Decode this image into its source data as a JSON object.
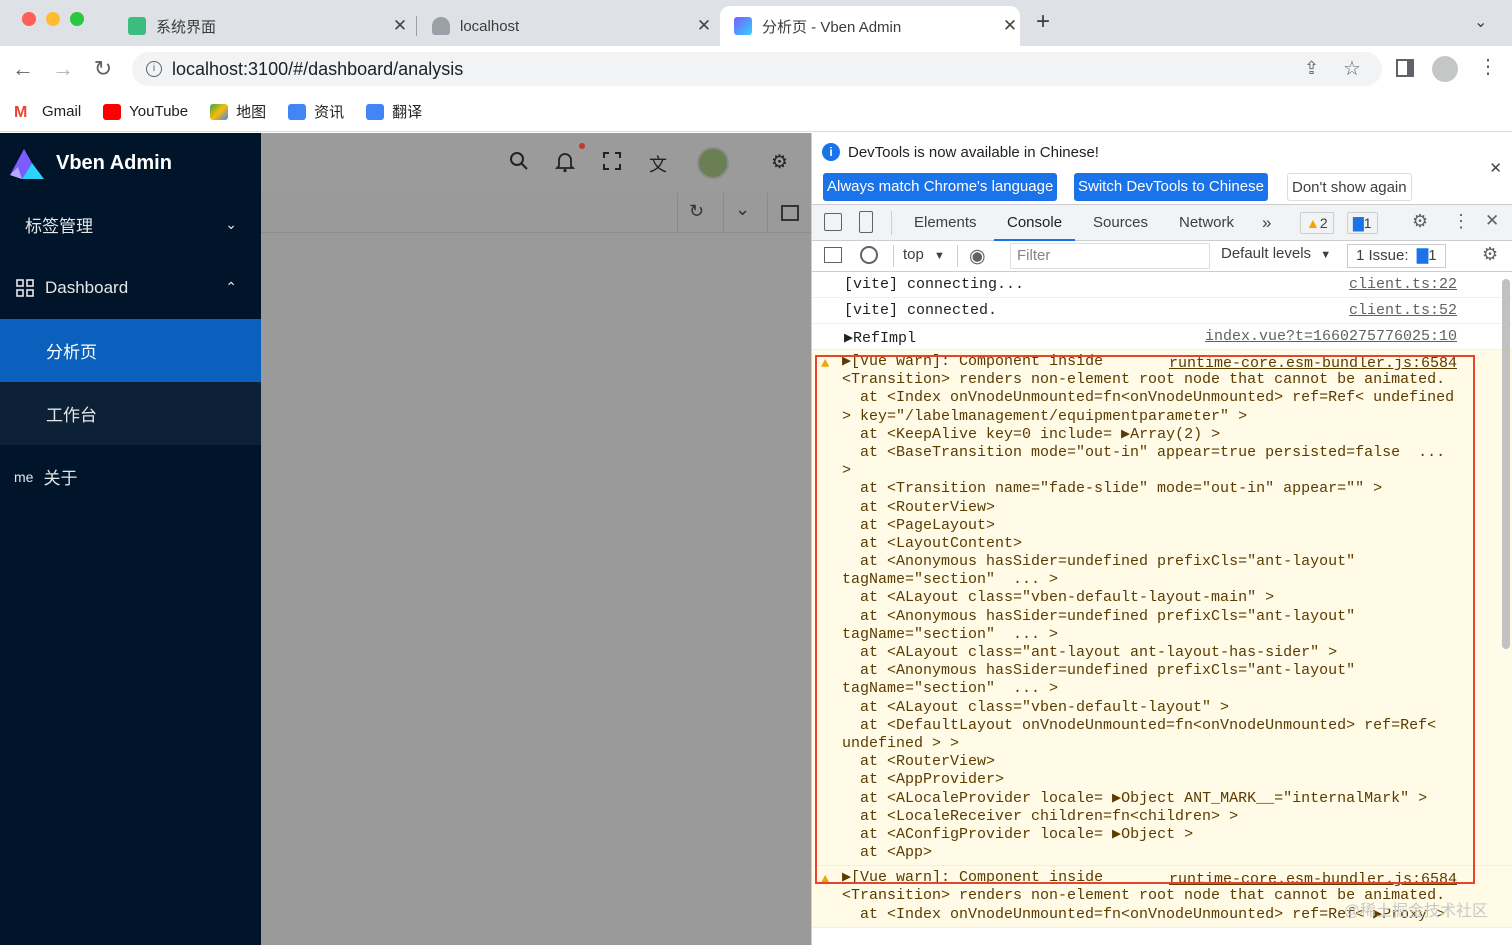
{
  "browser": {
    "tabs": [
      {
        "label": "系统界面",
        "active": false
      },
      {
        "label": "localhost",
        "active": false
      },
      {
        "label": "分析页 - Vben Admin",
        "active": true
      }
    ],
    "address": "localhost:3100/#/dashboard/analysis",
    "bookmarks": [
      "Gmail",
      "YouTube",
      "地图",
      "资讯",
      "翻译"
    ]
  },
  "app": {
    "brand": "Vben Admin",
    "menu": {
      "tag_management": "标签管理",
      "dashboard": "Dashboard",
      "analysis": "分析页",
      "workbench": "工作台",
      "about_prefix": "me",
      "about": "关于"
    }
  },
  "devtools": {
    "notice": "DevTools is now available in Chinese!",
    "btn_match": "Always match Chrome's language",
    "btn_switch": "Switch DevTools to Chinese",
    "btn_dont_show": "Don't show again",
    "tabs": [
      "Elements",
      "Console",
      "Sources",
      "Network"
    ],
    "more_tabs": "»",
    "warn_count": "2",
    "issue_count": "1",
    "context": "top",
    "filter_placeholder": "Filter",
    "levels": "Default levels",
    "issues_label": "1 Issue:",
    "issues_badge": "1"
  },
  "console": {
    "lines": [
      {
        "text": "[vite] connecting...",
        "source": "client.ts:22"
      },
      {
        "text": "[vite] connected.",
        "source": "client.ts:52"
      },
      {
        "text": "▶RefImpl",
        "source": "index.vue?t=1660275776025:10"
      }
    ],
    "warn1_source": "runtime-core.esm-bundler.js:6584",
    "warn1_lines": [
      "▶[Vue warn]: Component inside",
      "<Transition> renders non-element root node that cannot be animated.",
      "  at <Index onVnodeUnmounted=fn<onVnodeUnmounted> ref=Ref< undefined",
      "> key=\"/labelmanagement/equipmentparameter\" >",
      "  at <KeepAlive key=0 include= ▶Array(2) >",
      "  at <BaseTransition mode=\"out-in\" appear=true persisted=false  ...",
      ">",
      "  at <Transition name=\"fade-slide\" mode=\"out-in\" appear=\"\" >",
      "  at <RouterView>",
      "  at <PageLayout>",
      "  at <LayoutContent>",
      "  at <Anonymous hasSider=undefined prefixCls=\"ant-layout\"",
      "tagName=\"section\"  ... >",
      "  at <ALayout class=\"vben-default-layout-main\" >",
      "  at <Anonymous hasSider=undefined prefixCls=\"ant-layout\"",
      "tagName=\"section\"  ... >",
      "  at <ALayout class=\"ant-layout ant-layout-has-sider\" >",
      "  at <Anonymous hasSider=undefined prefixCls=\"ant-layout\"",
      "tagName=\"section\"  ... >",
      "  at <ALayout class=\"vben-default-layout\" >",
      "  at <DefaultLayout onVnodeUnmounted=fn<onVnodeUnmounted> ref=Ref<",
      "undefined > >",
      "  at <RouterView>",
      "  at <AppProvider>",
      "  at <ALocaleProvider locale= ▶Object ANT_MARK__=\"internalMark\" >",
      "  at <LocaleReceiver children=fn<children> >",
      "  at <AConfigProvider locale= ▶Object >",
      "  at <App>"
    ],
    "warn2_source": "runtime-core.esm-bundler.js:6584",
    "warn2_lines": [
      "▶[Vue warn]: Component inside",
      "<Transition> renders non-element root node that cannot be animated.",
      "  at <Index onVnodeUnmounted=fn<onVnodeUnmounted> ref=Ref< ▶Proxy >"
    ]
  },
  "watermark": "@稀土掘金技术社区",
  "colors": {
    "sidebar_bg": "#001529",
    "menu_active": "#0960bd",
    "devtools_accent": "#1a73e8",
    "warning_bg": "#fffbe6",
    "highlight_border": "#e8432b"
  }
}
